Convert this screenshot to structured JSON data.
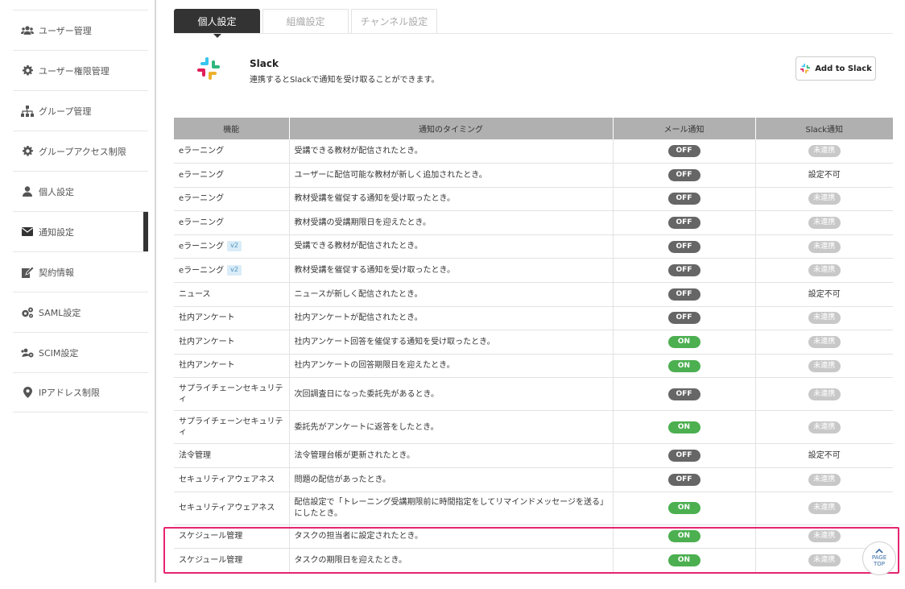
{
  "sidebar": {
    "items": [
      {
        "label": "ユーザー管理",
        "icon": "users-icon"
      },
      {
        "label": "ユーザー権限管理",
        "icon": "gear-icon"
      },
      {
        "label": "グループ管理",
        "icon": "sitemap-icon"
      },
      {
        "label": "グループアクセス制限",
        "icon": "gear-icon"
      },
      {
        "label": "個人設定",
        "icon": "user-icon"
      },
      {
        "label": "通知設定",
        "icon": "envelope-icon"
      },
      {
        "label": "契約情報",
        "icon": "edit-icon"
      },
      {
        "label": "SAML設定",
        "icon": "gears-icon"
      },
      {
        "label": "SCIM設定",
        "icon": "users-gear-icon"
      },
      {
        "label": "IPアドレス制限",
        "icon": "map-marker-icon"
      }
    ]
  },
  "tabs": [
    {
      "label": "個人設定"
    },
    {
      "label": "組織設定"
    },
    {
      "label": "チャンネル設定"
    }
  ],
  "slack": {
    "title": "Slack",
    "description": "連携するとSlackで通知を受け取ることができます。",
    "button_label": "Add to Slack"
  },
  "table": {
    "headers": [
      "機能",
      "通知のタイミング",
      "メール通知",
      "Slack通知"
    ],
    "rows": [
      {
        "feature": "eラーニング",
        "badge": "",
        "timing": "受講できる教材が配信されたとき。",
        "mail": "OFF",
        "slack": "未連携"
      },
      {
        "feature": "eラーニング",
        "badge": "",
        "timing": "ユーザーに配信可能な教材が新しく追加されたとき。",
        "mail": "OFF",
        "slack": "設定不可"
      },
      {
        "feature": "eラーニング",
        "badge": "",
        "timing": "教材受講を催促する通知を受け取ったとき。",
        "mail": "OFF",
        "slack": "未連携"
      },
      {
        "feature": "eラーニング",
        "badge": "",
        "timing": "教材受講の受講期限日を迎えたとき。",
        "mail": "OFF",
        "slack": "未連携"
      },
      {
        "feature": "eラーニング",
        "badge": "v2",
        "timing": "受講できる教材が配信されたとき。",
        "mail": "OFF",
        "slack": "未連携"
      },
      {
        "feature": "eラーニング",
        "badge": "v2",
        "timing": "教材受講を催促する通知を受け取ったとき。",
        "mail": "OFF",
        "slack": "未連携"
      },
      {
        "feature": "ニュース",
        "badge": "",
        "timing": "ニュースが新しく配信されたとき。",
        "mail": "OFF",
        "slack": "設定不可"
      },
      {
        "feature": "社内アンケート",
        "badge": "",
        "timing": "社内アンケートが配信されたとき。",
        "mail": "OFF",
        "slack": "未連携"
      },
      {
        "feature": "社内アンケート",
        "badge": "",
        "timing": "社内アンケート回答を催促する通知を受け取ったとき。",
        "mail": "ON",
        "slack": "未連携"
      },
      {
        "feature": "社内アンケート",
        "badge": "",
        "timing": "社内アンケートの回答期限日を迎えたとき。",
        "mail": "ON",
        "slack": "未連携"
      },
      {
        "feature": "サプライチェーンセキュリティ",
        "badge": "",
        "timing": "次回調査日になった委託先があるとき。",
        "mail": "OFF",
        "slack": "未連携",
        "tall": true
      },
      {
        "feature": "サプライチェーンセキュリティ",
        "badge": "",
        "timing": "委託先がアンケートに返答をしたとき。",
        "mail": "ON",
        "slack": "未連携",
        "tall": true
      },
      {
        "feature": "法令管理",
        "badge": "",
        "timing": "法令管理台帳が更新されたとき。",
        "mail": "OFF",
        "slack": "設定不可"
      },
      {
        "feature": "セキュリティアウェアネス",
        "badge": "",
        "timing": "問題の配信があったとき。",
        "mail": "OFF",
        "slack": "未連携"
      },
      {
        "feature": "セキュリティアウェアネス",
        "badge": "",
        "timing": "配信設定で「トレーニング受講期限前に時間指定をしてリマインドメッセージを送る」にしたとき。",
        "mail": "ON",
        "slack": "未連携",
        "tall": true
      },
      {
        "feature": "スケジュール管理",
        "badge": "",
        "timing": "タスクの担当者に設定されたとき。",
        "mail": "ON",
        "slack": "未連携"
      },
      {
        "feature": "スケジュール管理",
        "badge": "",
        "timing": "タスクの期限日を迎えたとき。",
        "mail": "ON",
        "slack": "未連携"
      }
    ]
  },
  "pagetop": {
    "line1": "PAGE",
    "line2": "TOP"
  },
  "colors": {
    "highlight": "#e6246f",
    "on": "#4caf50",
    "off": "#666666",
    "header": "#b0b0b0"
  }
}
